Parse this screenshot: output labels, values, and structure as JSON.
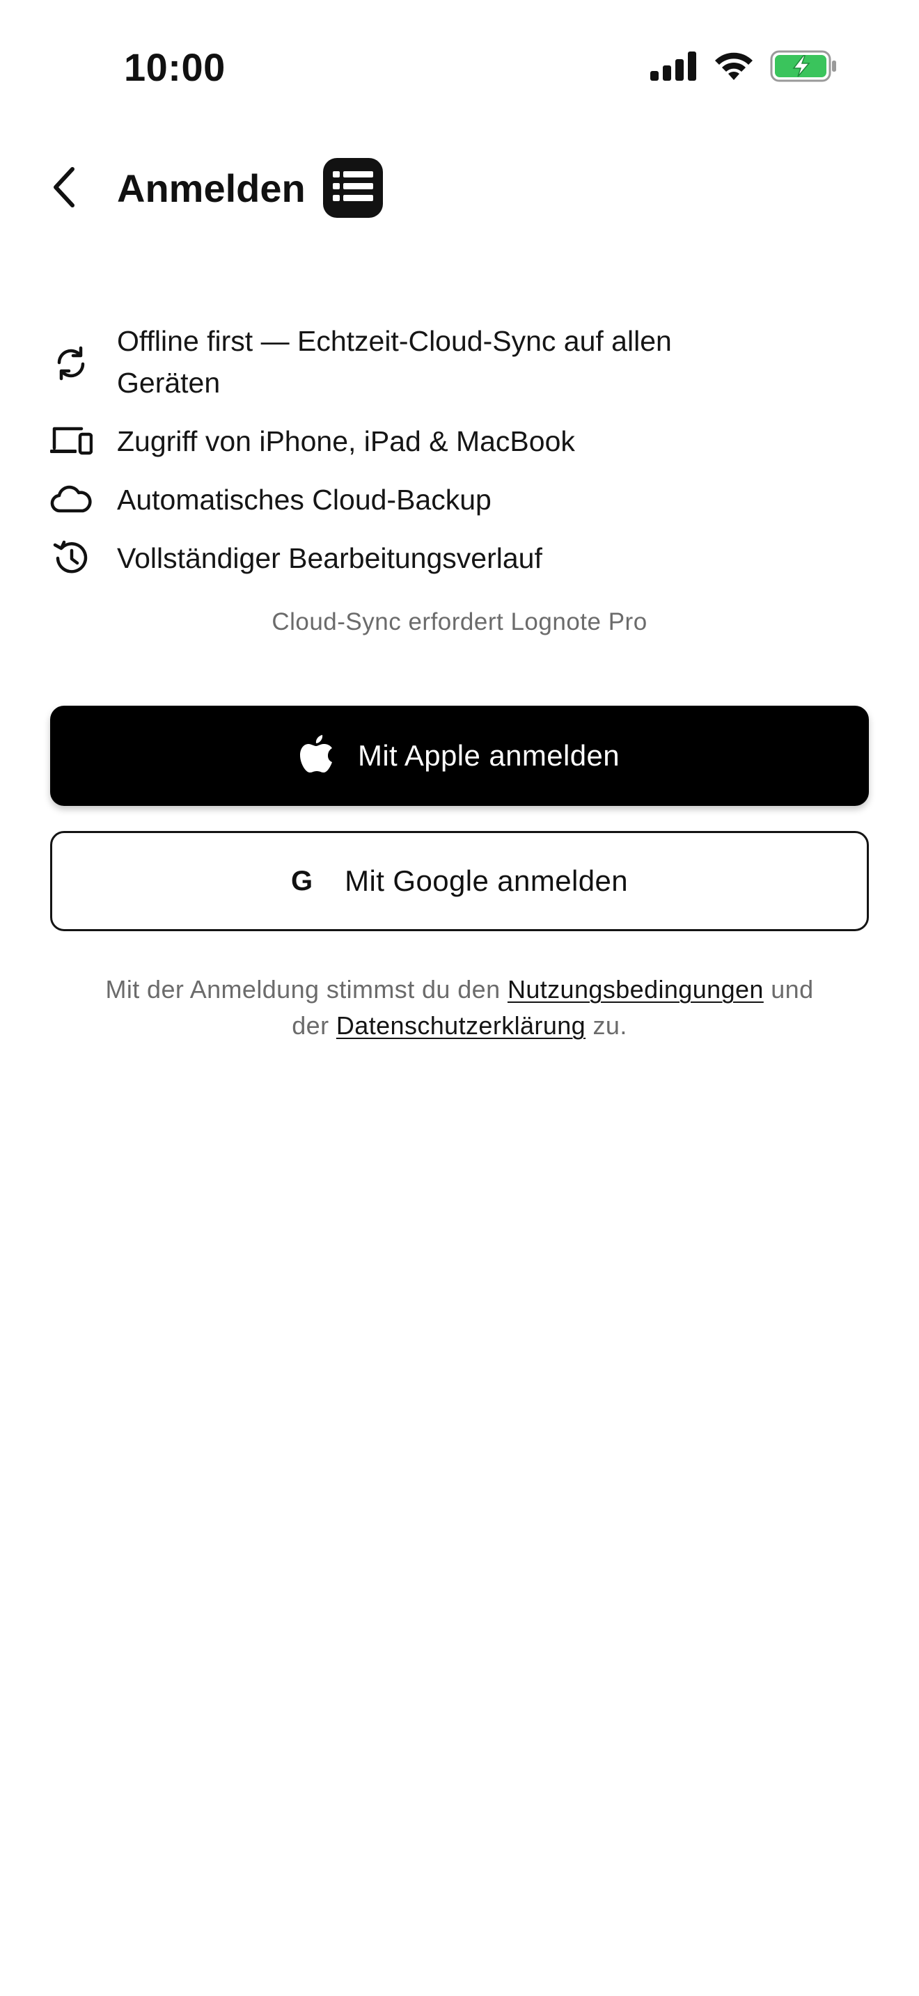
{
  "status_bar": {
    "time": "10:00",
    "icons": [
      "cellular-signal-icon",
      "wifi-icon",
      "battery-charging-icon"
    ],
    "battery_color": "#3ac45c"
  },
  "header": {
    "back_icon": "chevron-left-icon",
    "title": "Anmelden",
    "logo_icon": "list-icon"
  },
  "features": [
    {
      "icon": "sync-icon",
      "text_line1": "Offline first — Echtzeit-Cloud-Sync auf allen",
      "text_line2": "Geräten"
    },
    {
      "icon": "devices-icon",
      "text": "Zugriff von iPhone, iPad & MacBook"
    },
    {
      "icon": "cloud-icon",
      "text": "Automatisches Cloud-Backup"
    },
    {
      "icon": "history-icon",
      "text": "Vollständiger Bearbeitungsverlauf"
    }
  ],
  "pro_note": "Cloud-Sync erfordert Lognote Pro",
  "buttons": {
    "apple": {
      "icon": "apple-icon",
      "label": "Mit Apple anmelden"
    },
    "google": {
      "icon": "google-icon",
      "glyph": "G",
      "label": "Mit Google anmelden"
    }
  },
  "legal": {
    "prefix": "Mit der Anmeldung stimmst du den",
    "terms_link": "Nutzungsbedingungen",
    "middle": "und",
    "line2_prefix": "der",
    "privacy_link": "Datenschutzerklärung",
    "suffix": "zu."
  },
  "colors": {
    "primary": "#000000",
    "background": "#ffffff",
    "muted_text": "#6b6b6b"
  }
}
